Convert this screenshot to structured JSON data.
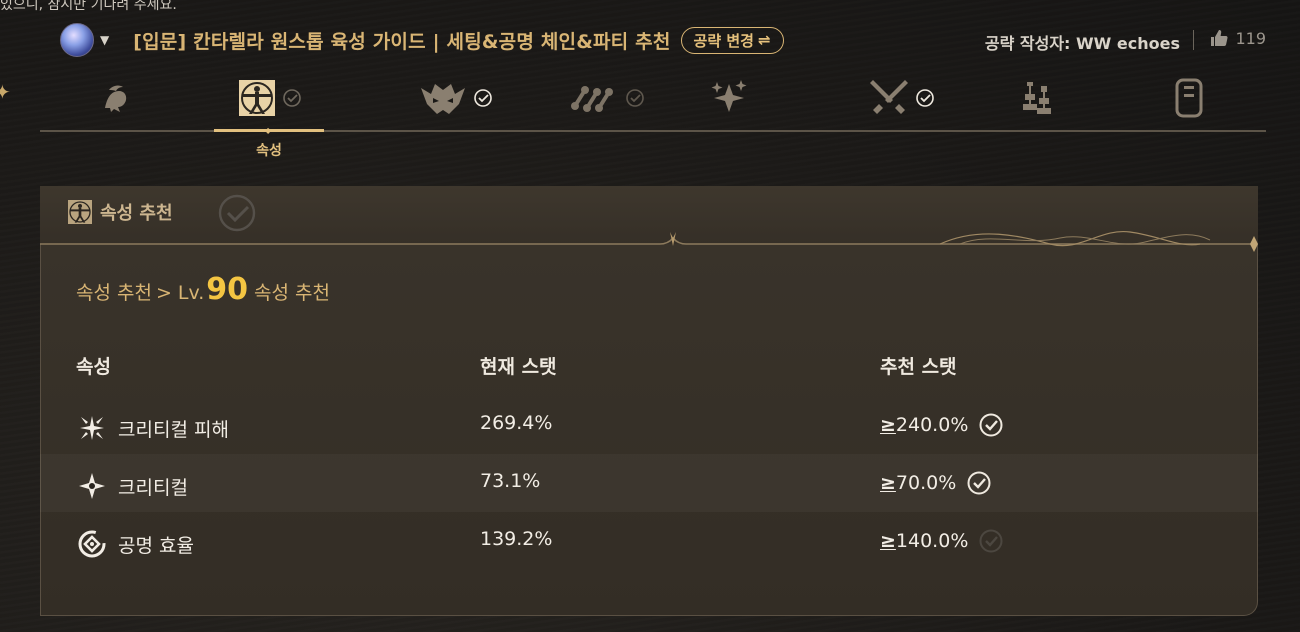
{
  "top_snippet": "있으니, 잠시만 기다려 주세요.",
  "header": {
    "title": "[입문] 칸타렐라 원스톱 육성 가이드 | 세팅&공명 체인&파티 추천",
    "change_label": "공략 변경",
    "change_icon": "⇌",
    "author": "공략 작성자: WW echoes",
    "likes": "119"
  },
  "tabs": [
    {
      "name": "character",
      "icon": "character-portrait-icon",
      "checked": null
    },
    {
      "name": "attributes",
      "icon": "vitruvian-icon",
      "checked": false,
      "active": true,
      "label": "속성"
    },
    {
      "name": "echo",
      "icon": "echo-mask-icon",
      "checked": true
    },
    {
      "name": "resonance-chain",
      "icon": "chain-nodes-icon",
      "checked": false
    },
    {
      "name": "skills",
      "icon": "sparkle-icon",
      "checked": null
    },
    {
      "name": "weapon",
      "icon": "crossed-swords-icon",
      "checked": true
    },
    {
      "name": "team",
      "icon": "chess-icon",
      "checked": null
    },
    {
      "name": "notes",
      "icon": "notebook-icon",
      "checked": null
    }
  ],
  "panel": {
    "title": "속성 추천",
    "breadcrumb": {
      "root": "속성 추천",
      "sep": ">",
      "lv_prefix": "Lv.",
      "lv": "90",
      "suffix": "속성 추천"
    },
    "columns": {
      "attr": "속성",
      "current": "현재 스탯",
      "recommended": "추천 스탯"
    },
    "rows": [
      {
        "icon": "crit-damage-icon",
        "name": "크리티컬 피해",
        "current": "269.4%",
        "ge": "≥",
        "recommended": "240.0%",
        "met": true
      },
      {
        "icon": "crit-rate-icon",
        "name": "크리티컬",
        "current": "73.1%",
        "ge": "≥",
        "recommended": "70.0%",
        "met": true
      },
      {
        "icon": "energy-regen-icon",
        "name": "공명 효율",
        "current": "139.2%",
        "ge": "≥",
        "recommended": "140.0%",
        "met": false
      }
    ]
  },
  "colors": {
    "gold": "#d9b574",
    "accent": "#e2c07f",
    "lv": "#f4c542",
    "bg": "#1a1816"
  }
}
